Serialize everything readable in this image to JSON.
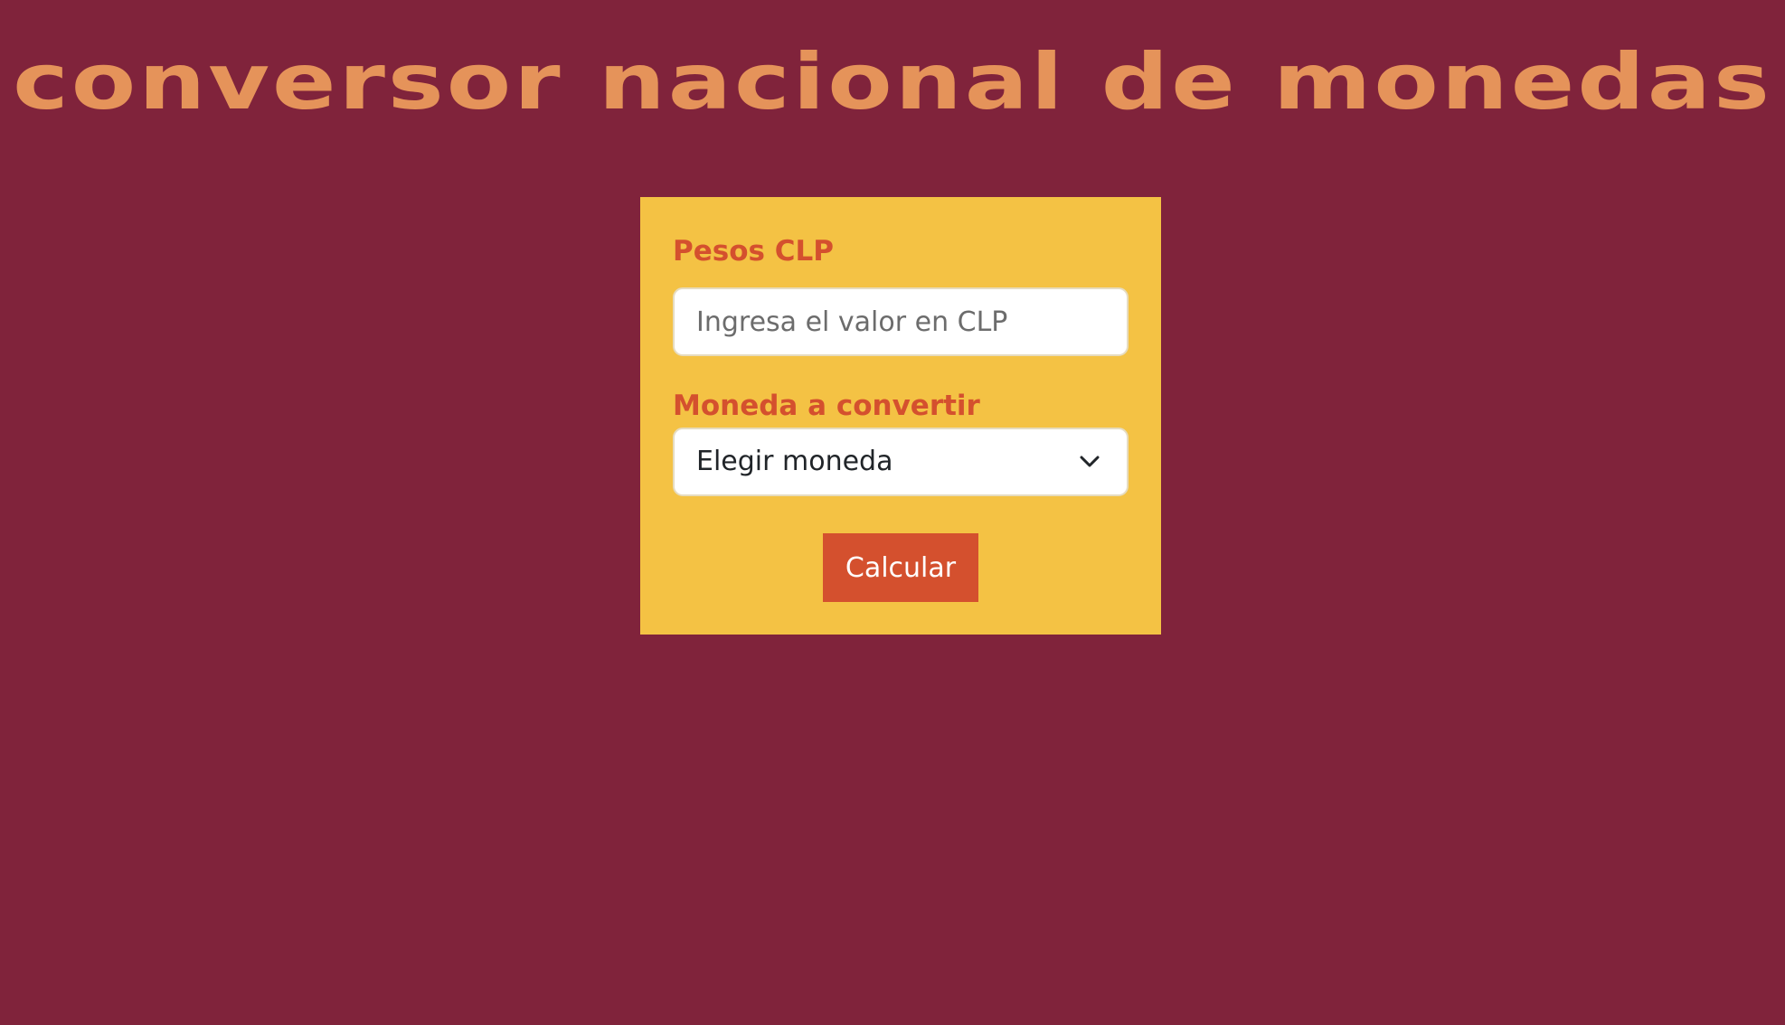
{
  "header": {
    "title": "conversor nacional de monedas"
  },
  "form": {
    "clp_label": "Pesos CLP",
    "clp_input": {
      "value": "",
      "placeholder": "Ingresa el valor en CLP"
    },
    "currency_label": "Moneda a convertir",
    "currency_select": {
      "selected": "Elegir moneda",
      "icon": "chevron-down-icon"
    },
    "submit_label": "Calcular"
  },
  "colors": {
    "background": "#80233b",
    "title": "#e5935a",
    "card": "#f4c244",
    "accent": "#d4502e",
    "input_background": "#ffffff"
  }
}
